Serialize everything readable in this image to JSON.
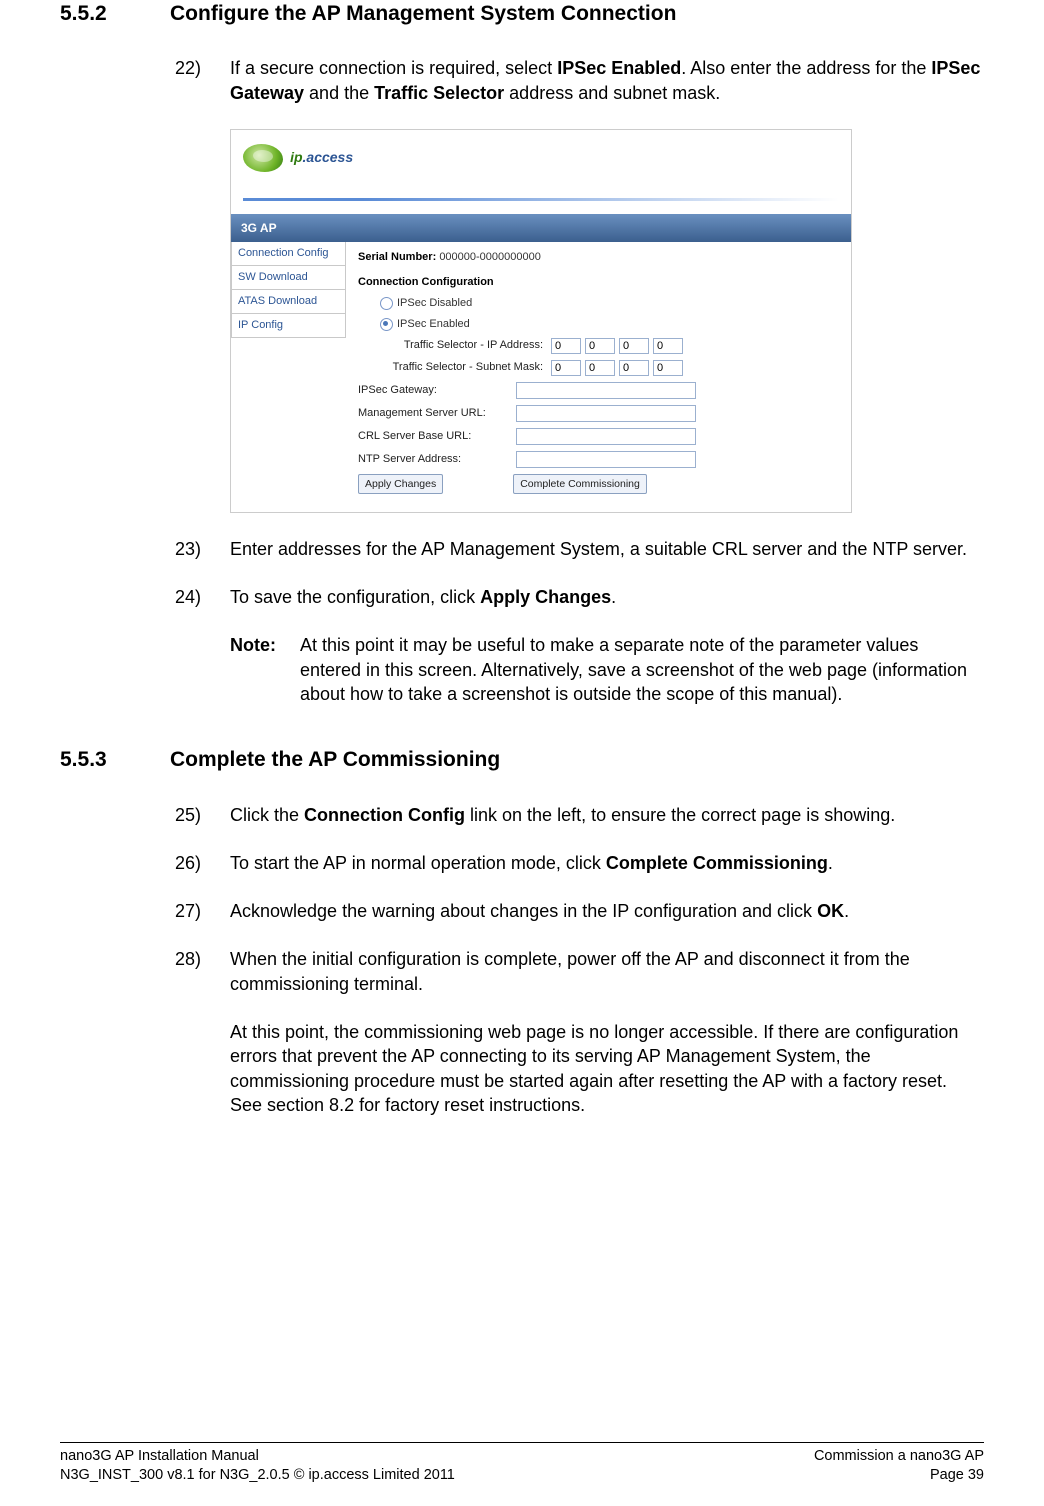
{
  "section1_num": "5.5.2",
  "section1_title": "Configure the AP Management System Connection",
  "step22_num": "22)",
  "step22_pre": "If a secure connection is required, select ",
  "step22_b1": "IPSec Enabled",
  "step22_mid1": ". Also enter the address for the ",
  "step22_b2": "IPSec Gateway",
  "step22_mid2": " and the ",
  "step22_b3": "Traffic Selector",
  "step22_post": " address and subnet mask.",
  "screenshot": {
    "logo_ip": "ip",
    "logo_access": ".access",
    "breadcrumb": "3G AP",
    "nav": [
      "Connection Config",
      "SW Download",
      "ATAS Download",
      "IP Config"
    ],
    "serial_lbl": "Serial Number:",
    "serial_val": "000000-0000000000",
    "form_title": "Connection Configuration",
    "radio_disabled": "IPSec Disabled",
    "radio_enabled": "IPSec Enabled",
    "ts_ip_lbl": "Traffic Selector - IP Address:",
    "ts_mask_lbl": "Traffic Selector - Subnet Mask:",
    "oct": "0",
    "gw_lbl": "IPSec Gateway:",
    "ms_lbl": "Management Server URL:",
    "crl_lbl": "CRL Server Base URL:",
    "ntp_lbl": "NTP Server Address:",
    "apply_btn": "Apply Changes",
    "complete_btn": "Complete Commissioning"
  },
  "step23_num": "23)",
  "step23_text": "Enter addresses for the AP Management System, a suitable CRL server and the NTP server.",
  "step24_num": "24)",
  "step24_pre": "To save the configuration, click ",
  "step24_b": "Apply Changes",
  "step24_post": ".",
  "note_label": "Note:",
  "note_text": "At this point it may be useful to make a separate note of the parameter values entered in this screen. Alternatively, save a screenshot of the web page (information about how to take a screenshot is outside the scope of this manual).",
  "section2_num": "5.5.3",
  "section2_title": "Complete the AP Commissioning",
  "step25_num": "25)",
  "step25_pre": "Click the ",
  "step25_b": "Connection Config",
  "step25_post": " link on the left, to ensure the correct page is showing.",
  "step26_num": "26)",
  "step26_pre": "To start the AP in normal operation mode, click ",
  "step26_b": "Complete Commissioning",
  "step26_post": ".",
  "step27_num": "27)",
  "step27_pre": "Acknowledge the warning about changes in the IP configuration and click ",
  "step27_b": "OK",
  "step27_post": ".",
  "step28_num": "28)",
  "step28_text": "When the initial configuration is complete, power off the AP and disconnect it from the commissioning terminal.",
  "step28_para2": "At this point, the commissioning web page is no longer accessible. If there are configuration errors that prevent the AP connecting to its serving AP Management System, the commissioning procedure must be started again after resetting the AP with a factory reset. See section 8.2 for factory reset instructions.",
  "footer_left1": "nano3G AP Installation Manual",
  "footer_left2": "N3G_INST_300 v8.1 for N3G_2.0.5 © ip.access Limited 2011",
  "footer_right1": "Commission a nano3G AP",
  "footer_right2": "Page 39"
}
